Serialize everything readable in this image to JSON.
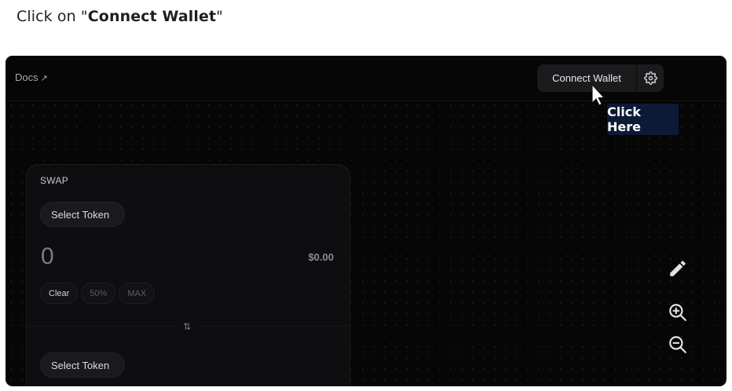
{
  "instruction": {
    "prefix": "Click on \"",
    "target": "Connect Wallet",
    "suffix": "\""
  },
  "topbar": {
    "docs_label": "Docs",
    "docs_arrow": "↗",
    "connect_label": "Connect Wallet",
    "settings_icon": "gear-icon"
  },
  "annotation": {
    "click_here": "Click Here"
  },
  "swap": {
    "title": "SWAP",
    "from": {
      "select_label": "Select Token",
      "amount": "0",
      "usd_value": "$0.00"
    },
    "chips": [
      "Clear",
      "50%",
      "MAX"
    ],
    "switch_icon": "⇅",
    "to": {
      "select_label": "Select Token"
    }
  },
  "tools": [
    "pencil-icon",
    "zoom-in-icon",
    "zoom-out-icon"
  ],
  "colors": {
    "background": "#060607",
    "panel": "#0e0e10",
    "callout": "#0c1a36"
  }
}
